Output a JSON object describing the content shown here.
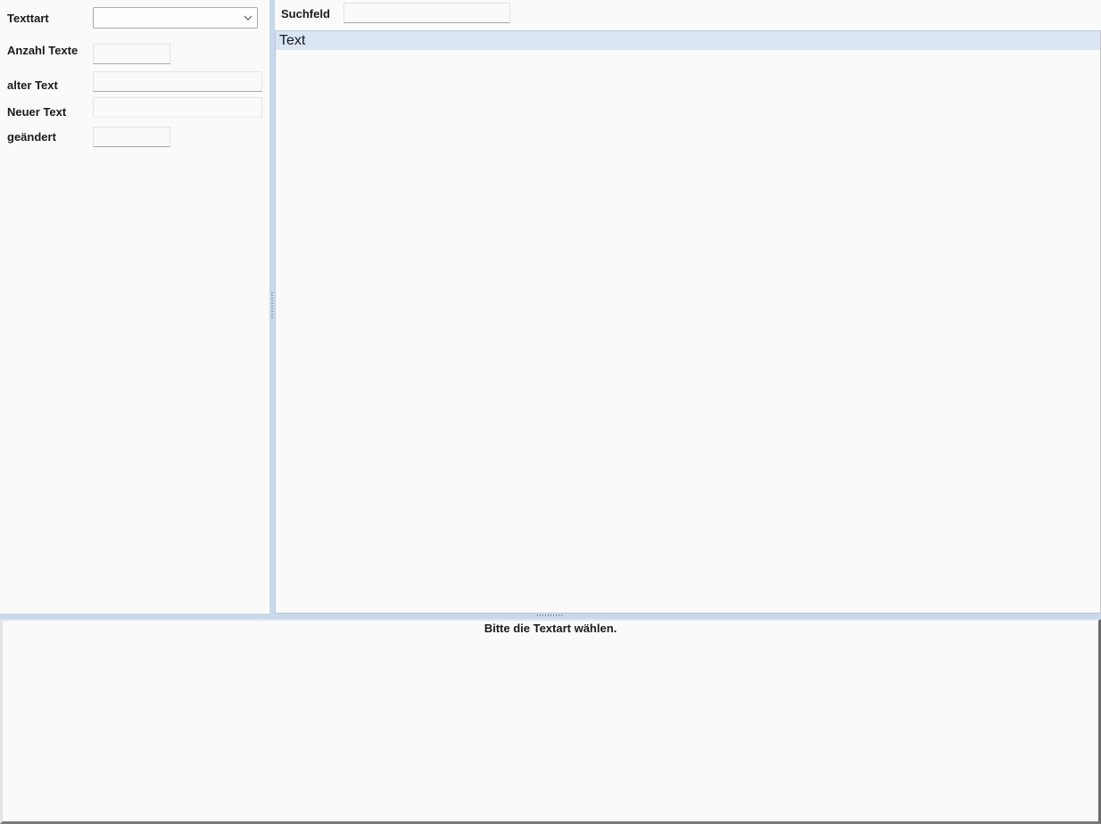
{
  "form": {
    "texttart_label": "Texttart",
    "texttart_value": "",
    "anzahl_texte_label": "Anzahl Texte",
    "anzahl_texte_value": "",
    "alter_text_label": "alter Text",
    "alter_text_value": "",
    "neuer_text_label": "Neuer Text",
    "neuer_text_value": "",
    "geaendert_label": "geändert",
    "geaendert_value": ""
  },
  "search": {
    "label": "Suchfeld",
    "value": ""
  },
  "list": {
    "header": "Text",
    "rows": []
  },
  "status": {
    "message": "Bitte die Textart wählen."
  },
  "icons": {
    "dropdown": "chevron-down-icon"
  },
  "colors": {
    "header_bg": "#d9e5f3",
    "splitter": "#c9d8ea",
    "background": "#fafafa"
  }
}
